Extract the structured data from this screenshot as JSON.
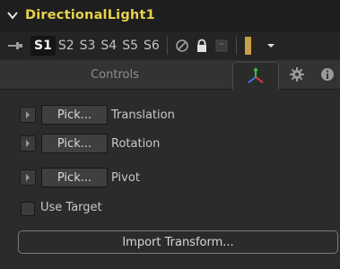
{
  "header": {
    "title": "DirectionalLight1",
    "collapse_icon": "chevron-down-icon"
  },
  "toolbar": {
    "pin_icon": "pin-icon",
    "slots": [
      "S1",
      "S2",
      "S3",
      "S4",
      "S5",
      "S6"
    ],
    "active_slot": "S1",
    "icons": [
      "disable-icon",
      "lock-icon",
      "reset-icon",
      "color-swatch-icon",
      "dropdown-icon"
    ]
  },
  "tabs": {
    "controls_label": "Controls",
    "active_tab": "3d-transform",
    "icons": [
      "transform-3d-icon",
      "gear-icon",
      "info-icon"
    ]
  },
  "controls": {
    "pick_label": "Pick...",
    "rows": [
      {
        "label": "Translation"
      },
      {
        "label": "Rotation"
      },
      {
        "label": "Pivot"
      }
    ],
    "use_target_label": "Use Target",
    "use_target_checked": false,
    "import_button_label": "Import Transform..."
  },
  "colors": {
    "title": "#e7d24c",
    "background": "#2b2b2b",
    "header": "#1e1e1e"
  }
}
